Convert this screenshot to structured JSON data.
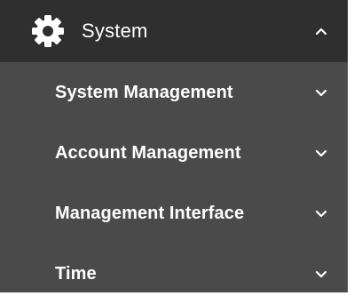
{
  "nav": {
    "header": {
      "icon": "gear-icon",
      "label": "System",
      "caret": "chevron-up-icon",
      "expanded": true
    },
    "items": [
      {
        "label": "System Management",
        "caret": "chevron-down-icon"
      },
      {
        "label": "Account Management",
        "caret": "chevron-down-icon"
      },
      {
        "label": "Management Interface",
        "caret": "chevron-down-icon"
      },
      {
        "label": "Time",
        "caret": "chevron-down-icon"
      }
    ]
  },
  "colors": {
    "header_bg": "#2f2f2f",
    "menu_bg": "#4a4a4a",
    "text": "#ffffff"
  }
}
